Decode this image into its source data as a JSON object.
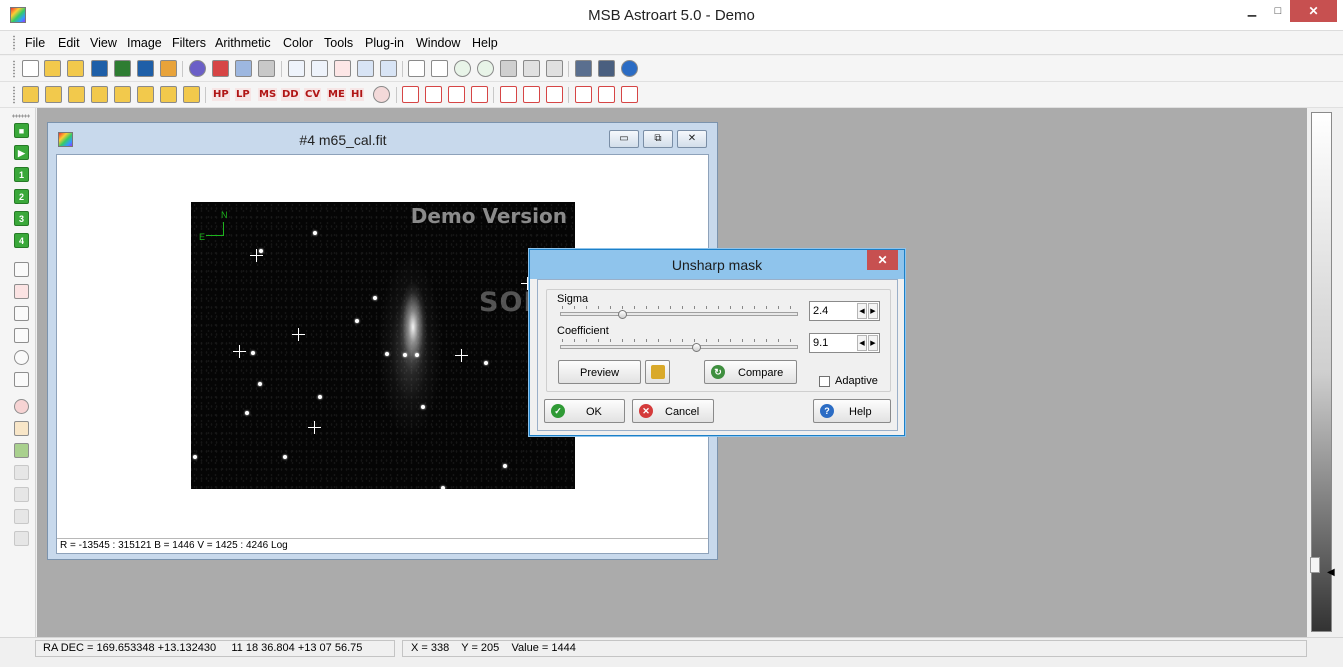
{
  "app": {
    "title": "MSB Astroart 5.0 - Demo"
  },
  "window_controls": {
    "minimize": "▁",
    "maximize": "□",
    "close": "✕"
  },
  "menu": [
    "File",
    "Edit",
    "View",
    "Image",
    "Filters",
    "Arithmetic",
    "Color",
    "Tools",
    "Plug-in",
    "Window",
    "Help"
  ],
  "toolbar2_labels": [
    "HP",
    "LP",
    "MS",
    "DD",
    "CV",
    "ME",
    "HI"
  ],
  "left_toolbar_labels": [
    "1",
    "2",
    "3",
    "4"
  ],
  "image_window": {
    "title": "#4 m65_cal.fit",
    "controls": {
      "minimize": "▭",
      "maximize": "⧉",
      "close": "✕"
    },
    "status": "R = -13545 : 315121    B = 1446    V = 1425 : 4246 Log",
    "compass": {
      "north": "N",
      "east": "E"
    },
    "overlay_text": "Demo Version",
    "watermark": "SOFTPEDIA"
  },
  "dialog": {
    "title": "Unsharp mask",
    "close": "✕",
    "sigma": {
      "label": "Sigma",
      "value": "2.4",
      "position": 0.26
    },
    "coefficient": {
      "label": "Coefficient",
      "value": "9.1",
      "position": 0.57
    },
    "preview_label": "Preview",
    "compare_label": "Compare",
    "adaptive_label": "Adaptive",
    "adaptive_checked": false,
    "ok_label": "OK",
    "cancel_label": "Cancel",
    "help_label": "Help"
  },
  "statusbar": {
    "radec": "RA DEC = 169.653348 +13.132430     11 18 36.804 +13 07 56.75",
    "xy": "X = 338    Y = 205    Value = 1444"
  },
  "colors": {
    "accent": "#1c80c8",
    "dialog_title_bg": "#8fc4ec",
    "close_red": "#c75050",
    "workspace": "#ababab"
  }
}
